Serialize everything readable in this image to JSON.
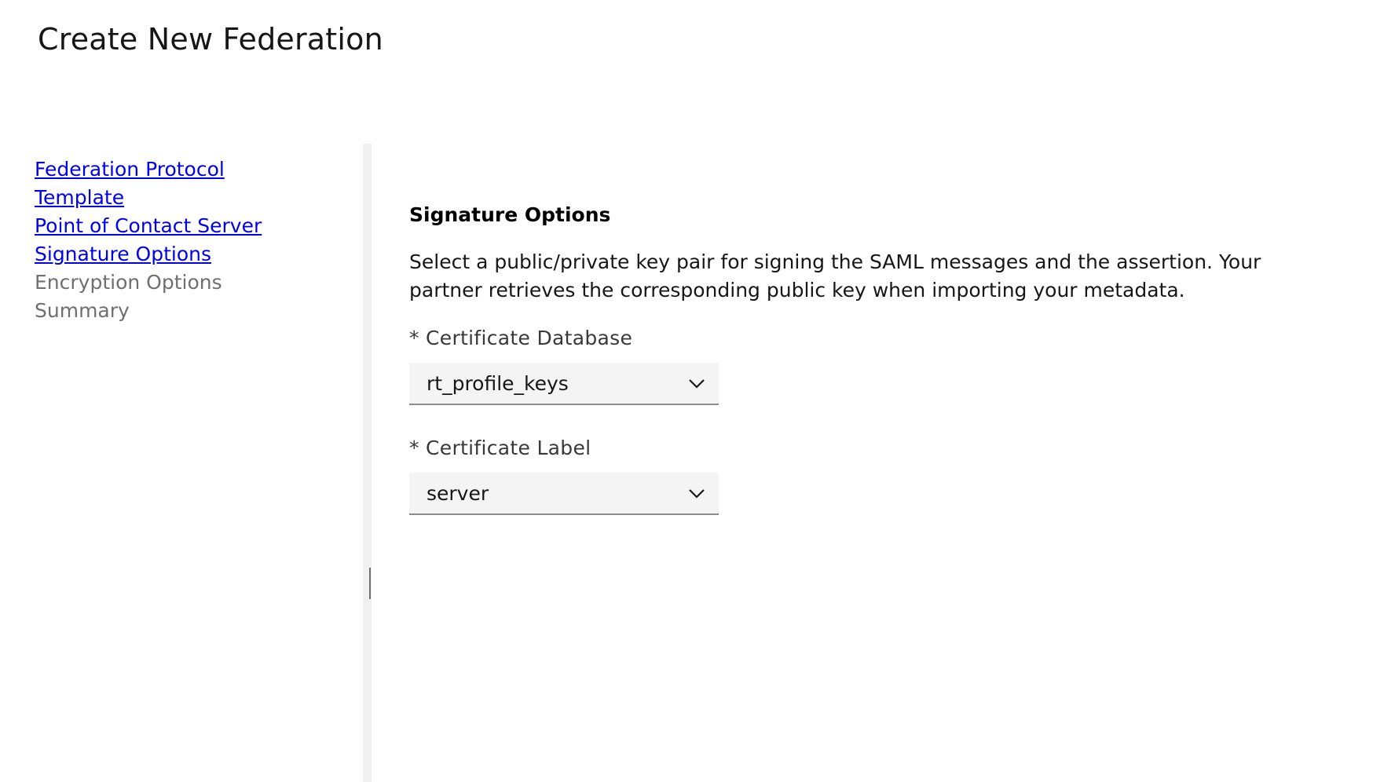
{
  "page": {
    "title": "Create New Federation"
  },
  "sidebar": {
    "items": [
      {
        "label": "Federation Protocol",
        "state": "link"
      },
      {
        "label": "Template",
        "state": "link"
      },
      {
        "label": "Point of Contact Server",
        "state": "link"
      },
      {
        "label": "Signature Options",
        "state": "link"
      },
      {
        "label": "Encryption Options",
        "state": "disabled"
      },
      {
        "label": "Summary",
        "state": "disabled"
      }
    ]
  },
  "main": {
    "section_title": "Signature Options",
    "description": "Select a public/private key pair for signing the SAML messages and the assertion. Your partner retrieves the corresponding public key when importing your metadata.",
    "fields": [
      {
        "label": "* Certificate Database",
        "value": "rt_profile_keys",
        "icon": "chevron-down-icon"
      },
      {
        "label": "* Certificate Label",
        "value": "server",
        "icon": "chevron-down-icon"
      }
    ]
  },
  "colors": {
    "link": "#0000ee",
    "disabled_text": "#6f6f6f",
    "select_bg": "#f4f4f4",
    "select_border": "#8d8d8d",
    "divider": "#f0f0f0"
  }
}
